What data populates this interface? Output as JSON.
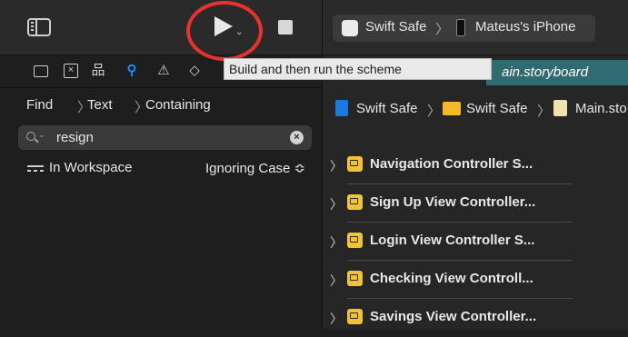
{
  "toolbar": {
    "tooltip": "Build and then run the scheme",
    "scheme": {
      "project": "Swift Safe",
      "separator": "〉",
      "device": "Mateus's iPhone"
    },
    "editor_tab": "ain.storyboard"
  },
  "find": {
    "mode": "Find",
    "type": "Text",
    "match": "Containing",
    "query": "resign",
    "scope": "In Workspace",
    "case": "Ignoring Case ≎"
  },
  "jump_bar": {
    "items": [
      "Swift Safe",
      "Swift Safe",
      "Main.sto"
    ],
    "separator": "〉"
  },
  "outline": {
    "items": [
      {
        "label": "Navigation Controller S..."
      },
      {
        "label": "Sign Up View Controller..."
      },
      {
        "label": "Login View Controller S..."
      },
      {
        "label": "Checking View Controll..."
      },
      {
        "label": "Savings View Controller..."
      }
    ]
  },
  "icons": {
    "accent": "#1a8cff",
    "highlight_circle": "#e8322e"
  }
}
